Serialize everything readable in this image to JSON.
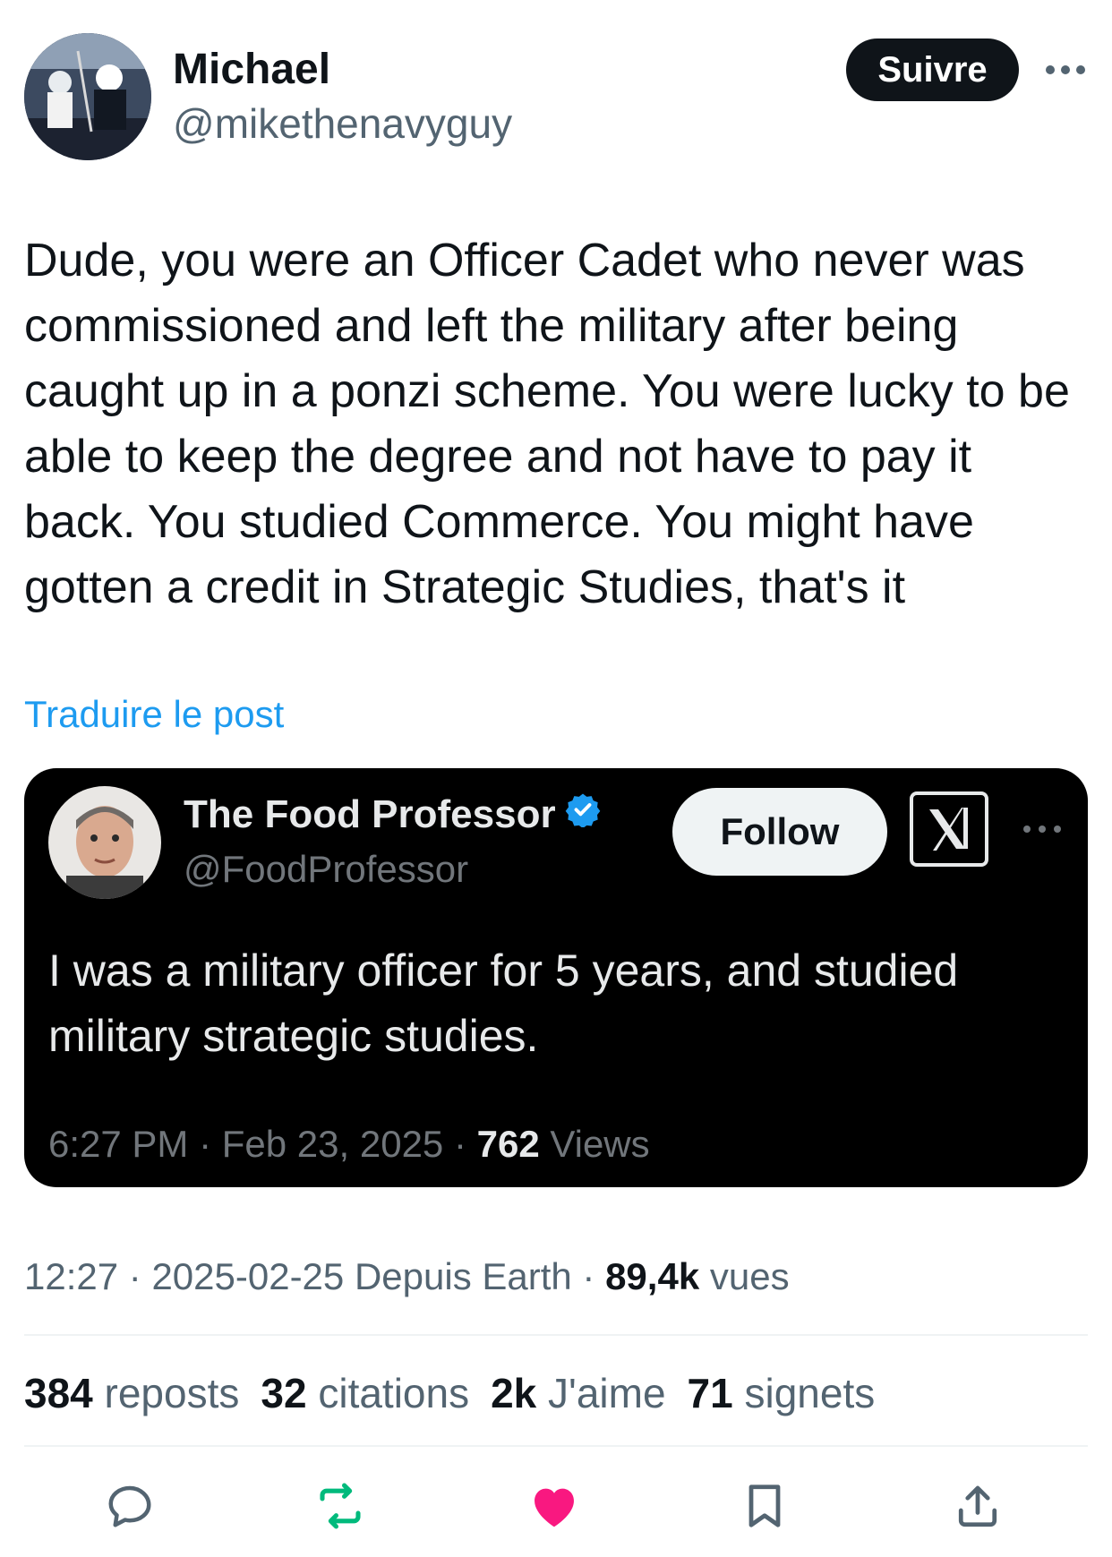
{
  "post": {
    "author": {
      "name": "Michael",
      "handle": "@mikethenavyguy"
    },
    "follow_label": "Suivre",
    "more_icon": "more-horizontal-icon",
    "text": "Dude, you were an Officer Cadet who never was commissioned and left the military after being caught up in a ponzi scheme. You were lucky to be able to keep the degree and not have to pay it back. You studied Commerce. You might have gotten a credit in Strategic Studies, that's it",
    "translate_label": "Traduire le post",
    "meta": {
      "time": "12:27",
      "date": "2025-02-25",
      "source": "Depuis Earth",
      "views_count": "89,4k",
      "views_label": "vues"
    },
    "stats": [
      {
        "count": "384",
        "label": "reposts"
      },
      {
        "count": "32",
        "label": "citations"
      },
      {
        "count": "2k",
        "label": "J'aime"
      },
      {
        "count": "71",
        "label": "signets"
      }
    ],
    "actions": [
      "reply-icon",
      "repost-icon",
      "like-icon",
      "bookmark-icon",
      "share-icon"
    ],
    "colors": {
      "accent": "#1d9bf0",
      "like_active": "#f91880",
      "repost": "#00ba7c"
    }
  },
  "quote": {
    "name": "The Food Professor",
    "handle": "@FoodProfessor",
    "verified": true,
    "follow_label": "Follow",
    "text": "I was a military officer for 5 years, and studied military strategic studies.",
    "time": "6:27 PM",
    "date": "Feb 23, 2025",
    "views_count": "762",
    "views_label": "Views"
  }
}
